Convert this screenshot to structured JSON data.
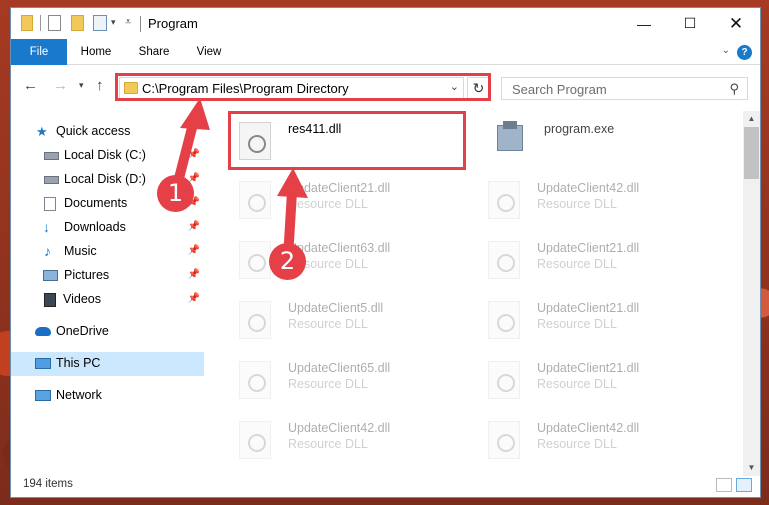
{
  "window": {
    "title": "Program"
  },
  "ribbon": {
    "tabs": [
      "File",
      "Home",
      "Share",
      "View"
    ],
    "help": "?"
  },
  "address": {
    "path": "C:\\Program Files\\Program Directory"
  },
  "search": {
    "placeholder": "Search Program"
  },
  "sidebar": {
    "items": [
      {
        "label": "Quick access",
        "icon": "star-icon",
        "pinned": false
      },
      {
        "label": "Local Disk (C:)",
        "icon": "drive-icon",
        "pinned": true
      },
      {
        "label": "Local Disk (D:)",
        "icon": "drive-icon",
        "pinned": true
      },
      {
        "label": "Documents",
        "icon": "documents-icon",
        "pinned": true
      },
      {
        "label": "Downloads",
        "icon": "download-icon",
        "pinned": true
      },
      {
        "label": "Music",
        "icon": "music-icon",
        "pinned": true
      },
      {
        "label": "Pictures",
        "icon": "pictures-icon",
        "pinned": true
      },
      {
        "label": "Videos",
        "icon": "videos-icon",
        "pinned": true
      },
      {
        "label": "OneDrive",
        "icon": "cloud-icon",
        "pinned": false
      },
      {
        "label": "This PC",
        "icon": "computer-icon",
        "pinned": false
      },
      {
        "label": "Network",
        "icon": "network-icon",
        "pinned": false
      }
    ]
  },
  "files": [
    {
      "name": "res411.dll",
      "type": ""
    },
    {
      "name": "program.exe",
      "type": ""
    },
    {
      "name": "UpdateClient21.dll",
      "type": "Resource DLL"
    },
    {
      "name": "UpdateClient42.dll",
      "type": "Resource DLL"
    },
    {
      "name": "UpdateClient63.dll",
      "type": "Resource DLL"
    },
    {
      "name": "UpdateClient21.dll",
      "type": "Resource DLL"
    },
    {
      "name": "UpdateClient5.dll",
      "type": "Resource DLL"
    },
    {
      "name": "UpdateClient21.dll",
      "type": "Resource DLL"
    },
    {
      "name": "UpdateClient65.dll",
      "type": "Resource DLL"
    },
    {
      "name": "UpdateClient21.dll",
      "type": "Resource DLL"
    },
    {
      "name": "UpdateClient42.dll",
      "type": "Resource DLL"
    },
    {
      "name": "UpdateClient42.dll",
      "type": "Resource DLL"
    }
  ],
  "status": {
    "item_count": "194 items"
  },
  "annotations": {
    "step1": "1",
    "step2": "2",
    "color": "#e53f48"
  },
  "colors": {
    "accent": "#1979ca",
    "selected": "#cce8ff"
  }
}
